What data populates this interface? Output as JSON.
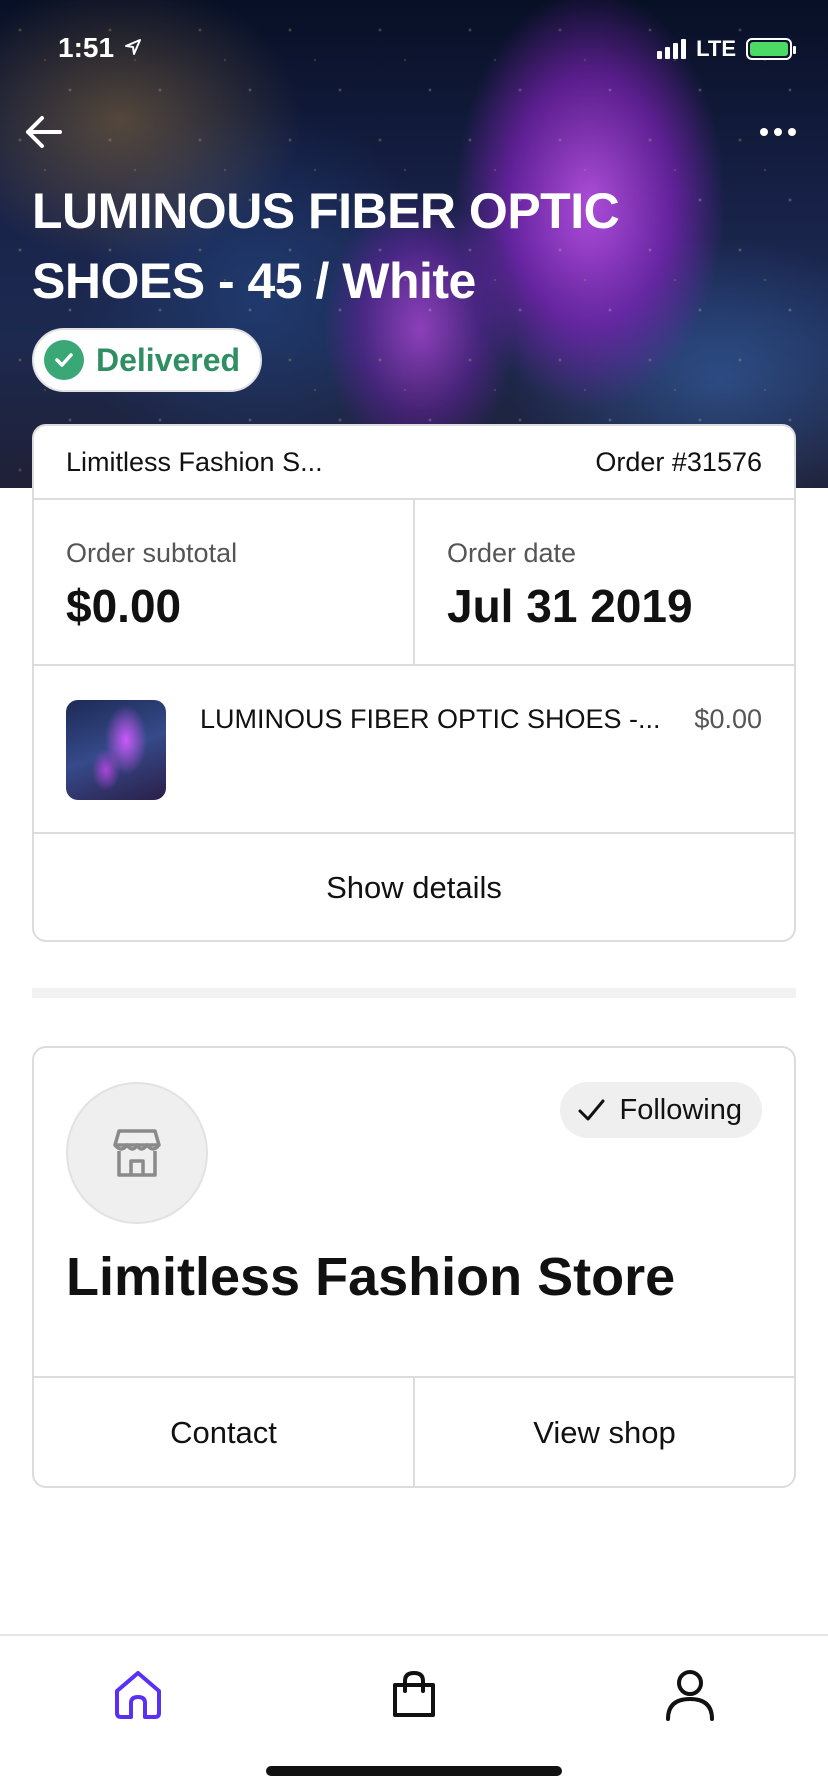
{
  "status_bar": {
    "time": "1:51",
    "network": "LTE"
  },
  "hero": {
    "title": "LUMINOUS FIBER OPTIC SHOES - 45 / White",
    "status_badge": "Delivered"
  },
  "order": {
    "shop_name": "Limitless Fashion S...",
    "order_number": "Order #31576",
    "subtotal_label": "Order subtotal",
    "subtotal_value": "$0.00",
    "date_label": "Order date",
    "date_value": "Jul 31 2019",
    "item": {
      "name": "LUMINOUS FIBER OPTIC SHOES -...",
      "price": "$0.00"
    },
    "show_details": "Show details"
  },
  "store": {
    "name": "Limitless Fashion Store",
    "follow_label": "Following",
    "contact_label": "Contact",
    "view_shop_label": "View shop"
  },
  "nav": {
    "items": [
      "home-icon",
      "bag-icon",
      "profile-icon"
    ],
    "accent": "#5a31f4"
  },
  "colors": {
    "delivered_green": "#2f8f63",
    "check_green": "#3aa776"
  }
}
